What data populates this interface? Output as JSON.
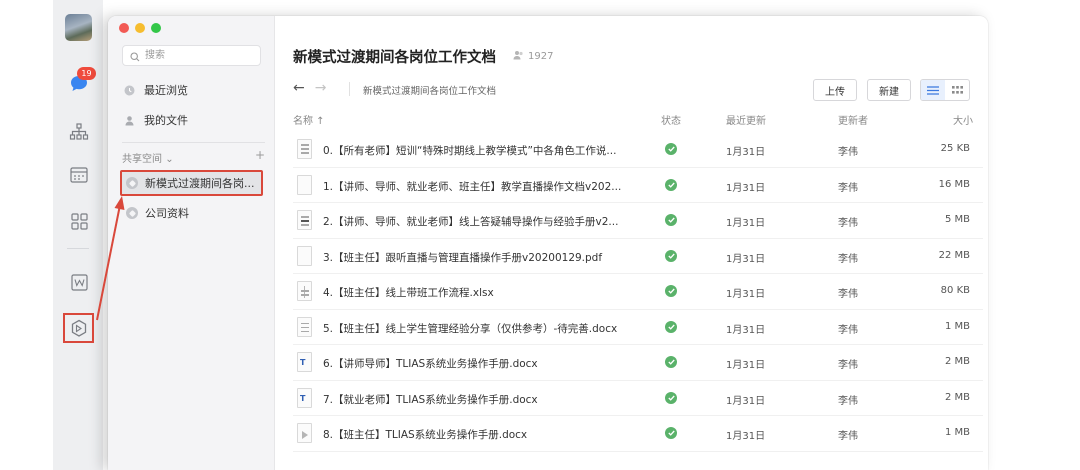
{
  "dock": {
    "chat_badge": "19",
    "icons": [
      "avatar",
      "chat-icon",
      "org-chart-icon",
      "calendar-icon",
      "apps-grid-icon",
      "word-doc-icon",
      "drive-icon"
    ]
  },
  "sidebar": {
    "search_placeholder": "搜索",
    "nav": [
      {
        "label": "最近浏览",
        "icon": "clock-icon"
      },
      {
        "label": "我的文件",
        "icon": "user-icon"
      }
    ],
    "section_label": "共享空间",
    "section_add": "+",
    "spaces": [
      {
        "label": "新模式过渡期间各岗...",
        "active": true
      },
      {
        "label": "公司资料",
        "active": false
      }
    ]
  },
  "header": {
    "title": "新模式过渡期间各岗位工作文档",
    "member_count": "1927",
    "breadcrumb": "新模式过渡期间各岗位工作文档",
    "back_icon": "←",
    "forward_icon": "→",
    "upload_label": "上传",
    "new_label": "新建"
  },
  "table": {
    "columns": {
      "name": "名称 ↑",
      "status": "状态",
      "updated": "最近更新",
      "updater": "更新者",
      "size": "大小"
    },
    "rows": [
      {
        "name": "0.【所有老师】短训“特殊时期线上教学模式”中各角色工作说...",
        "date": "1月31日",
        "updater": "李伟",
        "size": "25 KB",
        "kind": "doc"
      },
      {
        "name": "1.【讲师、导师、就业老师、班主任】教学直播操作文档v202...",
        "date": "1月31日",
        "updater": "李伟",
        "size": "16 MB",
        "kind": "pdf"
      },
      {
        "name": "2.【讲师、导师、就业老师】线上答疑辅导操作与经验手册v2...",
        "date": "1月31日",
        "updater": "李伟",
        "size": "5 MB",
        "kind": "doc"
      },
      {
        "name": "3.【班主任】跟听直播与管理直播操作手册v20200129.pdf",
        "date": "1月31日",
        "updater": "李伟",
        "size": "22 MB",
        "kind": "pdf"
      },
      {
        "name": "4.【班主任】线上带班工作流程.xlsx",
        "date": "1月31日",
        "updater": "李伟",
        "size": "80 KB",
        "kind": "xlsx"
      },
      {
        "name": "5.【班主任】线上学生管理经验分享（仅供参考）-待完善.docx",
        "date": "1月31日",
        "updater": "李伟",
        "size": "1 MB",
        "kind": "doc"
      },
      {
        "name": "6.【讲师导师】TLIAS系统业务操作手册.docx",
        "date": "1月31日",
        "updater": "李伟",
        "size": "2 MB",
        "kind": "docx"
      },
      {
        "name": "7.【就业老师】TLIAS系统业务操作手册.docx",
        "date": "1月31日",
        "updater": "李伟",
        "size": "2 MB",
        "kind": "docx"
      },
      {
        "name": "8.【班主任】TLIAS系统业务操作手册.docx",
        "date": "1月31日",
        "updater": "李伟",
        "size": "1 MB",
        "kind": "pdf"
      }
    ]
  },
  "colors": {
    "accent": "#2f6fde",
    "status_ok": "#5ab26a",
    "annotation": "#d9483b",
    "badge": "#ef4b3c"
  }
}
